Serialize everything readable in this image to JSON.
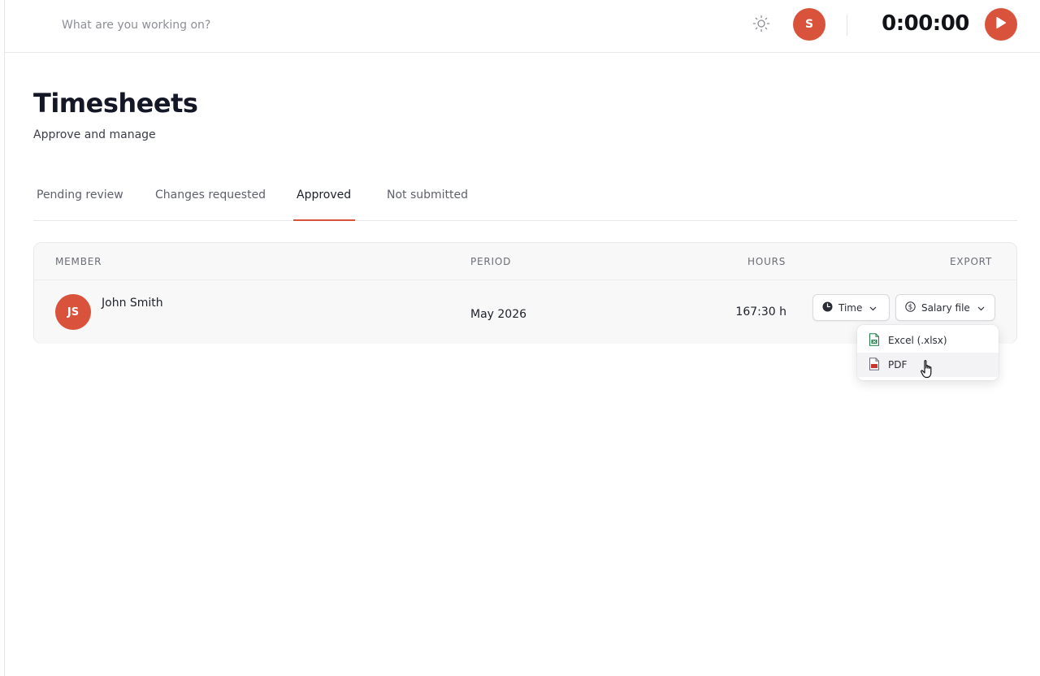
{
  "topbar": {
    "task_placeholder": "What are you working on?",
    "task_value": "",
    "user_initial": "S",
    "timer": "0:00:00"
  },
  "header": {
    "title": "Timesheets",
    "subtitle": "Approve and manage"
  },
  "tabs": [
    {
      "label": "Pending review",
      "active": false
    },
    {
      "label": "Changes requested",
      "active": false
    },
    {
      "label": "Approved",
      "active": true
    },
    {
      "label": "Not submitted",
      "active": false
    }
  ],
  "table": {
    "columns": {
      "member": "MEMBER",
      "period": "PERIOD",
      "hours": "HOURS",
      "export": "EXPORT"
    },
    "rows": [
      {
        "initials": "JS",
        "name": "John Smith",
        "period": "May 2026",
        "hours": "167:30 h",
        "time_button": "Time",
        "salary_button": "Salary file"
      }
    ]
  },
  "export_menu": {
    "items": [
      {
        "label": "Excel (.xlsx)",
        "icon": "excel-file-icon"
      },
      {
        "label": "PDF",
        "icon": "pdf-file-icon",
        "hovered": true
      }
    ]
  },
  "colors": {
    "accent": "#d9533c",
    "text": "#1d2029",
    "muted": "#6b6e76",
    "excel_green": "#1f7a45",
    "pdf_red": "#c8362b"
  }
}
